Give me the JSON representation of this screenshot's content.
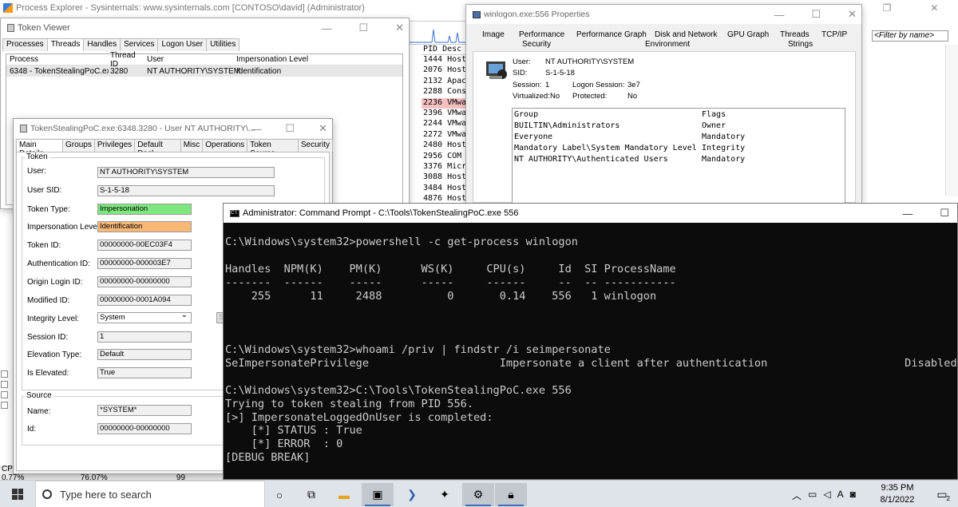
{
  "pe": {
    "title": "Process Explorer - Sysinternals: www.sysinternals.com [CONTOSO\\david] (Administrator)",
    "filter_placeholder": "<Filter by name>",
    "pid_header": "PID Desc",
    "pid_rows": [
      "1444 Host",
      "2076 Host",
      "2132 Apach",
      "2288 Conso",
      "2236 VMwar",
      "2396 VMwar",
      "2244 VMwar",
      "2272 VMwar",
      "2480 Host",
      "2956 COM S",
      "3376 Micro",
      "3088 Host",
      "3484 Host",
      "4876 Host"
    ],
    "status": {
      "cpu": "CPU Usage: 0.77%",
      "commit": "Commit Charge: 76.07%",
      "processes": "Processes: 99"
    }
  },
  "token_viewer": {
    "title": "Token Viewer",
    "tabs": [
      "Processes",
      "Threads",
      "Handles",
      "Services",
      "Logon User",
      "Utilities"
    ],
    "active_tab": 1,
    "columns": [
      "Process",
      "Thread ID",
      "User",
      "Impersonation Level"
    ],
    "rows": [
      [
        "6348 - TokenStealingPoC.exe",
        "3280",
        "NT AUTHORITY\\SYSTEM",
        "Identification"
      ]
    ]
  },
  "token_dialog": {
    "title": "TokenStealingPoC.exe:6348.3280 - User NT AUTHORITY\\...",
    "tabs": [
      "Main Details",
      "Groups",
      "Privileges",
      "Default Dacl",
      "Misc",
      "Operations",
      "Token Source",
      "Security"
    ],
    "token_group": "Token",
    "source_group": "Source",
    "fields": {
      "user": {
        "label": "User:",
        "value": "NT AUTHORITY\\SYSTEM"
      },
      "user_sid": {
        "label": "User SID:",
        "value": "S-1-5-18"
      },
      "token_type": {
        "label": "Token Type:",
        "value": "Impersonation"
      },
      "imp_level": {
        "label": "Impersonation Level:",
        "value": "Identification"
      },
      "token_id": {
        "label": "Token ID:",
        "value": "00000000-00EC03F4"
      },
      "auth_id": {
        "label": "Authentication ID:",
        "value": "00000000-000003E7"
      },
      "origin_id": {
        "label": "Origin Login ID:",
        "value": "00000000-00000000"
      },
      "modified_id": {
        "label": "Modified ID:",
        "value": "00000000-0001A094"
      },
      "integrity": {
        "label": "Integrity Level:",
        "value": "System"
      },
      "session_id": {
        "label": "Session ID:",
        "value": "1"
      },
      "elevation": {
        "label": "Elevation Type:",
        "value": "Default"
      },
      "is_elevated": {
        "label": "Is Elevated:",
        "value": "True"
      },
      "src_name": {
        "label": "Name:",
        "value": "*SYSTEM*"
      },
      "src_id": {
        "label": "Id:",
        "value": "00000000-00000000"
      }
    },
    "set_button": "Se"
  },
  "props": {
    "title": "winlogon.exe:556 Properties",
    "tabs_top": [
      "Image",
      "Performance",
      "Performance Graph",
      "Disk and Network",
      "GPU Graph",
      "Threads",
      "TCP/IP"
    ],
    "tabs_bottom": [
      "Security",
      "Environment",
      "Strings"
    ],
    "user_label": "User:",
    "user_value": "NT AUTHORITY\\SYSTEM",
    "sid_label": "SID:",
    "sid_value": "S-1-5-18",
    "session_label": "Session:",
    "session_value": "1",
    "logon_label": "Logon Session:",
    "logon_value": "3e7",
    "virtualized_label": "Virtualized:",
    "virtualized_value": "No",
    "protected_label": "Protected:",
    "protected_value": "No",
    "group_header": "Group",
    "flags_header": "Flags",
    "groups": [
      {
        "name": "BUILTIN\\Administrators",
        "flag": "Owner"
      },
      {
        "name": "Everyone",
        "flag": "Mandatory"
      },
      {
        "name": "Mandatory Label\\System Mandatory Level",
        "flag": "Integrity"
      },
      {
        "name": "NT AUTHORITY\\Authenticated Users",
        "flag": "Mandatory"
      }
    ]
  },
  "cmd": {
    "title": "Administrator: Command Prompt - C:\\Tools\\TokenStealingPoC.exe  556",
    "lines": [
      "C:\\Windows\\system32>powershell -c get-process winlogon",
      "",
      "Handles  NPM(K)    PM(K)      WS(K)     CPU(s)     Id  SI ProcessName",
      "-------  ------    -----      -----     ------     --  -- -----------",
      "    255      11     2488          0       0.14    556   1 winlogon",
      "",
      "",
      "",
      "C:\\Windows\\system32>whoami /priv | findstr /i seimpersonate",
      "SeImpersonatePrivilege                    Impersonate a client after authentication                     Disabled",
      "",
      "C:\\Windows\\system32>C:\\Tools\\TokenStealingPoC.exe 556",
      "Trying to token stealing from PID 556.",
      "[>] ImpersonateLoggedOnUser is completed:",
      "    [*] STATUS : True",
      "    [*] ERROR  : 0",
      "[DEBUG BREAK]"
    ]
  },
  "taskbar": {
    "search_placeholder": "Type here to search",
    "time": "9:35 PM",
    "date": "8/1/2022",
    "notif_count": "2",
    "ime": "A"
  }
}
